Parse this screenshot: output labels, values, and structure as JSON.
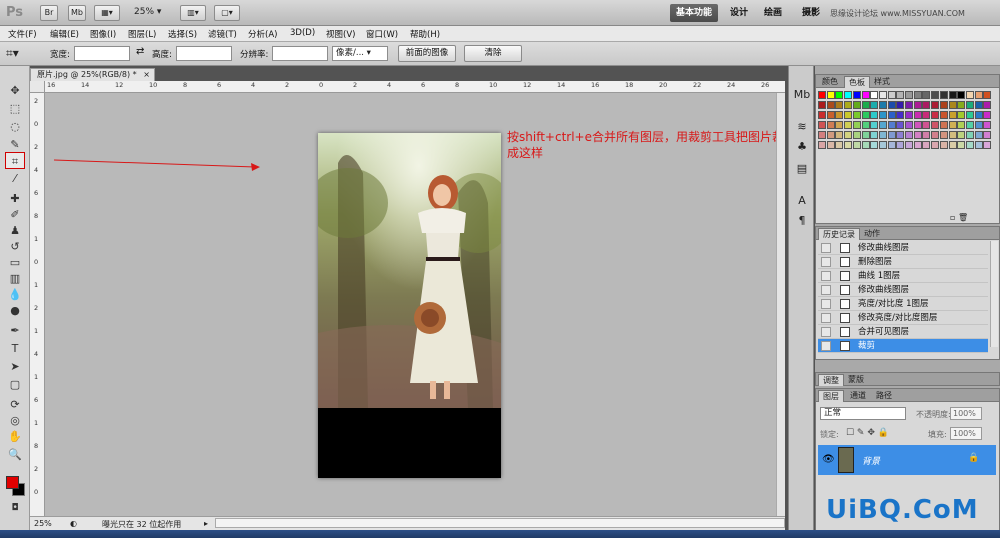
{
  "appbar": {
    "logo": "Ps",
    "bridge_label": "Br",
    "minibridge_label": "Mb",
    "zoom": "25%",
    "workspaces": [
      "基本功能",
      "设计",
      "绘画",
      "摄影"
    ],
    "active_workspace": "基本功能",
    "site_mark": "思缘设计论坛 www.MISSYUAN.COM"
  },
  "menubar": {
    "items": [
      "文件(F)",
      "编辑(E)",
      "图像(I)",
      "图层(L)",
      "选择(S)",
      "滤镜(T)",
      "分析(A)",
      "3D(D)",
      "视图(V)",
      "窗口(W)",
      "帮助(H)"
    ]
  },
  "options": {
    "width_label": "宽度:",
    "height_label": "高度:",
    "resolution_label": "分辨率:",
    "unit_value": "像素/...",
    "front_image_label": "前面的图像",
    "clear_label": "清除"
  },
  "document": {
    "tab_title": "原片.jpg @ 25%(RGB/8) *",
    "ruler_top": [
      "16",
      "14",
      "12",
      "10",
      "8",
      "6",
      "4",
      "2",
      "0",
      "2",
      "4",
      "6",
      "8",
      "10",
      "12",
      "14",
      "16",
      "18",
      "20",
      "22",
      "24",
      "26"
    ],
    "ruler_left": [
      "2",
      "0",
      "2",
      "4",
      "6",
      "8",
      "1",
      "0",
      "1",
      "2",
      "1",
      "4",
      "1",
      "6",
      "1",
      "8",
      "2",
      "0"
    ],
    "annotation": "按shift+ctrl+e合并所有图层，用裁剪工具把图片裁成这样",
    "status_zoom": "25%",
    "status_text": "曝光只在 32 位起作用"
  },
  "color_panel": {
    "tabs": [
      "颜色",
      "色板",
      "样式"
    ],
    "active_tab": "色板"
  },
  "history_panel": {
    "tabs": [
      "历史记录",
      "动作"
    ],
    "items": [
      {
        "label": "修改曲线图层"
      },
      {
        "label": "删除图层"
      },
      {
        "label": "曲线 1图层"
      },
      {
        "label": "修改曲线图层"
      },
      {
        "label": "亮度/对比度 1图层"
      },
      {
        "label": "修改亮度/对比度图层"
      },
      {
        "label": "合并可见图层"
      },
      {
        "label": "裁剪"
      }
    ],
    "selected": "裁剪"
  },
  "adjust_panel": {
    "tabs": [
      "调整",
      "蒙版"
    ]
  },
  "layers_panel": {
    "tabs": [
      "图层",
      "通道",
      "路径"
    ],
    "blend_mode": "正常",
    "opacity_label": "不透明度:",
    "opacity_value": "100%",
    "lock_label": "锁定:",
    "fill_label": "填充:",
    "fill_value": "100%",
    "layer_name": "背景"
  },
  "colors": {
    "foreground": "#e00000",
    "background": "#000000",
    "annotation": "#d81818",
    "selection": "#3d8ee6"
  },
  "watermark": "UiBQ.CoM"
}
